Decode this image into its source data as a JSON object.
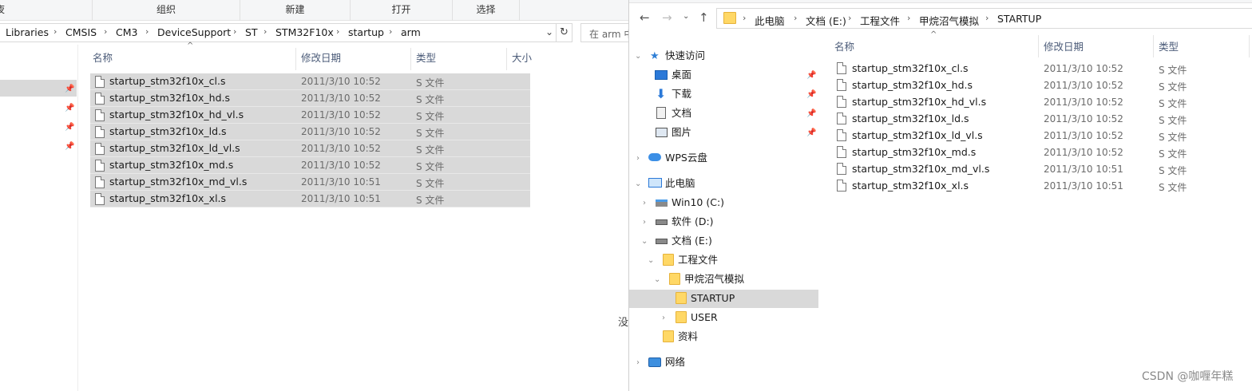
{
  "left": {
    "ribbon": {
      "partial": "夜",
      "organize": "组织",
      "new": "新建",
      "open": "打开",
      "select": "选择"
    },
    "breadcrumbs": [
      "Libraries",
      "CMSIS",
      "CM3",
      "DeviceSupport",
      "ST",
      "STM32F10x",
      "startup",
      "arm"
    ],
    "search_placeholder": "在 arm 中",
    "columns": {
      "name": "名称",
      "date": "修改日期",
      "type": "类型",
      "size": "大小"
    },
    "files": [
      {
        "name": "startup_stm32f10x_cl.s",
        "date": "2011/3/10 10:52",
        "type": "S 文件"
      },
      {
        "name": "startup_stm32f10x_hd.s",
        "date": "2011/3/10 10:52",
        "type": "S 文件"
      },
      {
        "name": "startup_stm32f10x_hd_vl.s",
        "date": "2011/3/10 10:52",
        "type": "S 文件"
      },
      {
        "name": "startup_stm32f10x_ld.s",
        "date": "2011/3/10 10:52",
        "type": "S 文件"
      },
      {
        "name": "startup_stm32f10x_ld_vl.s",
        "date": "2011/3/10 10:52",
        "type": "S 文件"
      },
      {
        "name": "startup_stm32f10x_md.s",
        "date": "2011/3/10 10:52",
        "type": "S 文件"
      },
      {
        "name": "startup_stm32f10x_md_vl.s",
        "date": "2011/3/10 10:51",
        "type": "S 文件"
      },
      {
        "name": "startup_stm32f10x_xl.s",
        "date": "2011/3/10 10:51",
        "type": "S 文件"
      }
    ],
    "stray_text": "没"
  },
  "right": {
    "breadcrumbs": [
      "此电脑",
      "文档 (E:)",
      "工程文件",
      "甲烷沼气模拟",
      "STARTUP"
    ],
    "columns": {
      "name": "名称",
      "date": "修改日期",
      "type": "类型"
    },
    "tree": {
      "quick_access": "快速访问",
      "desktop": "桌面",
      "downloads": "下载",
      "documents": "文档",
      "pictures": "图片",
      "wps": "WPS云盘",
      "this_pc": "此电脑",
      "drive_c": "Win10 (C:)",
      "drive_d": "软件 (D:)",
      "drive_e": "文档 (E:)",
      "project": "工程文件",
      "methane": "甲烷沼气模拟",
      "startup": "STARTUP",
      "user": "USER",
      "data": "资料",
      "network": "网络"
    },
    "files": [
      {
        "name": "startup_stm32f10x_cl.s",
        "date": "2011/3/10 10:52",
        "type": "S 文件"
      },
      {
        "name": "startup_stm32f10x_hd.s",
        "date": "2011/3/10 10:52",
        "type": "S 文件"
      },
      {
        "name": "startup_stm32f10x_hd_vl.s",
        "date": "2011/3/10 10:52",
        "type": "S 文件"
      },
      {
        "name": "startup_stm32f10x_ld.s",
        "date": "2011/3/10 10:52",
        "type": "S 文件"
      },
      {
        "name": "startup_stm32f10x_ld_vl.s",
        "date": "2011/3/10 10:52",
        "type": "S 文件"
      },
      {
        "name": "startup_stm32f10x_md.s",
        "date": "2011/3/10 10:52",
        "type": "S 文件"
      },
      {
        "name": "startup_stm32f10x_md_vl.s",
        "date": "2011/3/10 10:51",
        "type": "S 文件"
      },
      {
        "name": "startup_stm32f10x_xl.s",
        "date": "2011/3/10 10:51",
        "type": "S 文件"
      }
    ]
  },
  "watermark": "CSDN @咖喱年糕"
}
